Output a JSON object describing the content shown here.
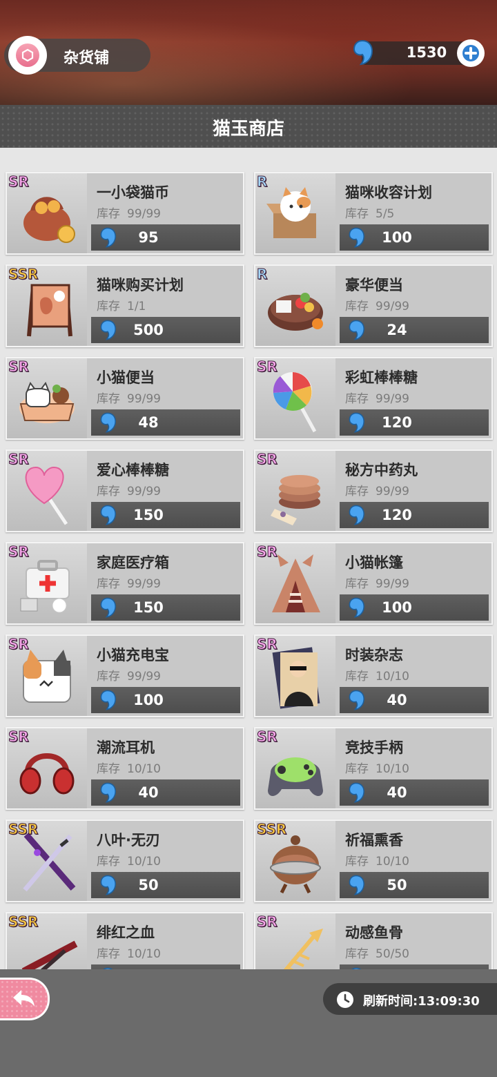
{
  "header": {
    "shop_label": "杂货铺",
    "currency_amount": "1530",
    "add_currency_icon": "plus-icon",
    "shop_badge_icon": "cube-icon"
  },
  "title": "猫玉商店",
  "stock_label": "库存",
  "currency_icon": "blue-drop-icon",
  "items": [
    {
      "rarity": "SR",
      "name": "一小袋猫币",
      "stock": "99/99",
      "price": "95",
      "art": "coin-bag"
    },
    {
      "rarity": "R",
      "name": "猫咪收容计划",
      "stock": "5/5",
      "price": "100",
      "art": "cat-box"
    },
    {
      "rarity": "SSR",
      "name": "猫咪购买计划",
      "stock": "1/1",
      "price": "500",
      "art": "signboard"
    },
    {
      "rarity": "R",
      "name": "豪华便当",
      "stock": "99/99",
      "price": "24",
      "art": "bento"
    },
    {
      "rarity": "SR",
      "name": "小猫便当",
      "stock": "99/99",
      "price": "48",
      "art": "cat-bento"
    },
    {
      "rarity": "SR",
      "name": "彩虹棒棒糖",
      "stock": "99/99",
      "price": "120",
      "art": "rainbow-lollipop"
    },
    {
      "rarity": "SR",
      "name": "爱心棒棒糖",
      "stock": "99/99",
      "price": "150",
      "art": "heart-lollipop"
    },
    {
      "rarity": "SR",
      "name": "秘方中药丸",
      "stock": "99/99",
      "price": "120",
      "art": "herbal-pills"
    },
    {
      "rarity": "SR",
      "name": "家庭医疗箱",
      "stock": "99/99",
      "price": "150",
      "art": "medkit"
    },
    {
      "rarity": "SR",
      "name": "小猫帐篷",
      "stock": "99/99",
      "price": "100",
      "art": "cat-tent"
    },
    {
      "rarity": "SR",
      "name": "小猫充电宝",
      "stock": "99/99",
      "price": "100",
      "art": "power-bank"
    },
    {
      "rarity": "SR",
      "name": "时装杂志",
      "stock": "10/10",
      "price": "40",
      "art": "magazine"
    },
    {
      "rarity": "SR",
      "name": "潮流耳机",
      "stock": "10/10",
      "price": "40",
      "art": "headphones"
    },
    {
      "rarity": "SR",
      "name": "竞技手柄",
      "stock": "10/10",
      "price": "40",
      "art": "gamepad"
    },
    {
      "rarity": "SSR",
      "name": "八叶·无刃",
      "stock": "10/10",
      "price": "50",
      "art": "swords"
    },
    {
      "rarity": "SSR",
      "name": "祈福熏香",
      "stock": "10/10",
      "price": "50",
      "art": "incense-burner"
    },
    {
      "rarity": "SSR",
      "name": "绯红之血",
      "stock": "10/10",
      "price": "",
      "art": "scissors"
    },
    {
      "rarity": "SR",
      "name": "动感鱼骨",
      "stock": "50/50",
      "price": "",
      "art": "fish-bone"
    }
  ],
  "footer": {
    "back_icon": "back-arrow-icon",
    "refresh_label": "刷新时间:",
    "refresh_time": "13:09:30"
  }
}
